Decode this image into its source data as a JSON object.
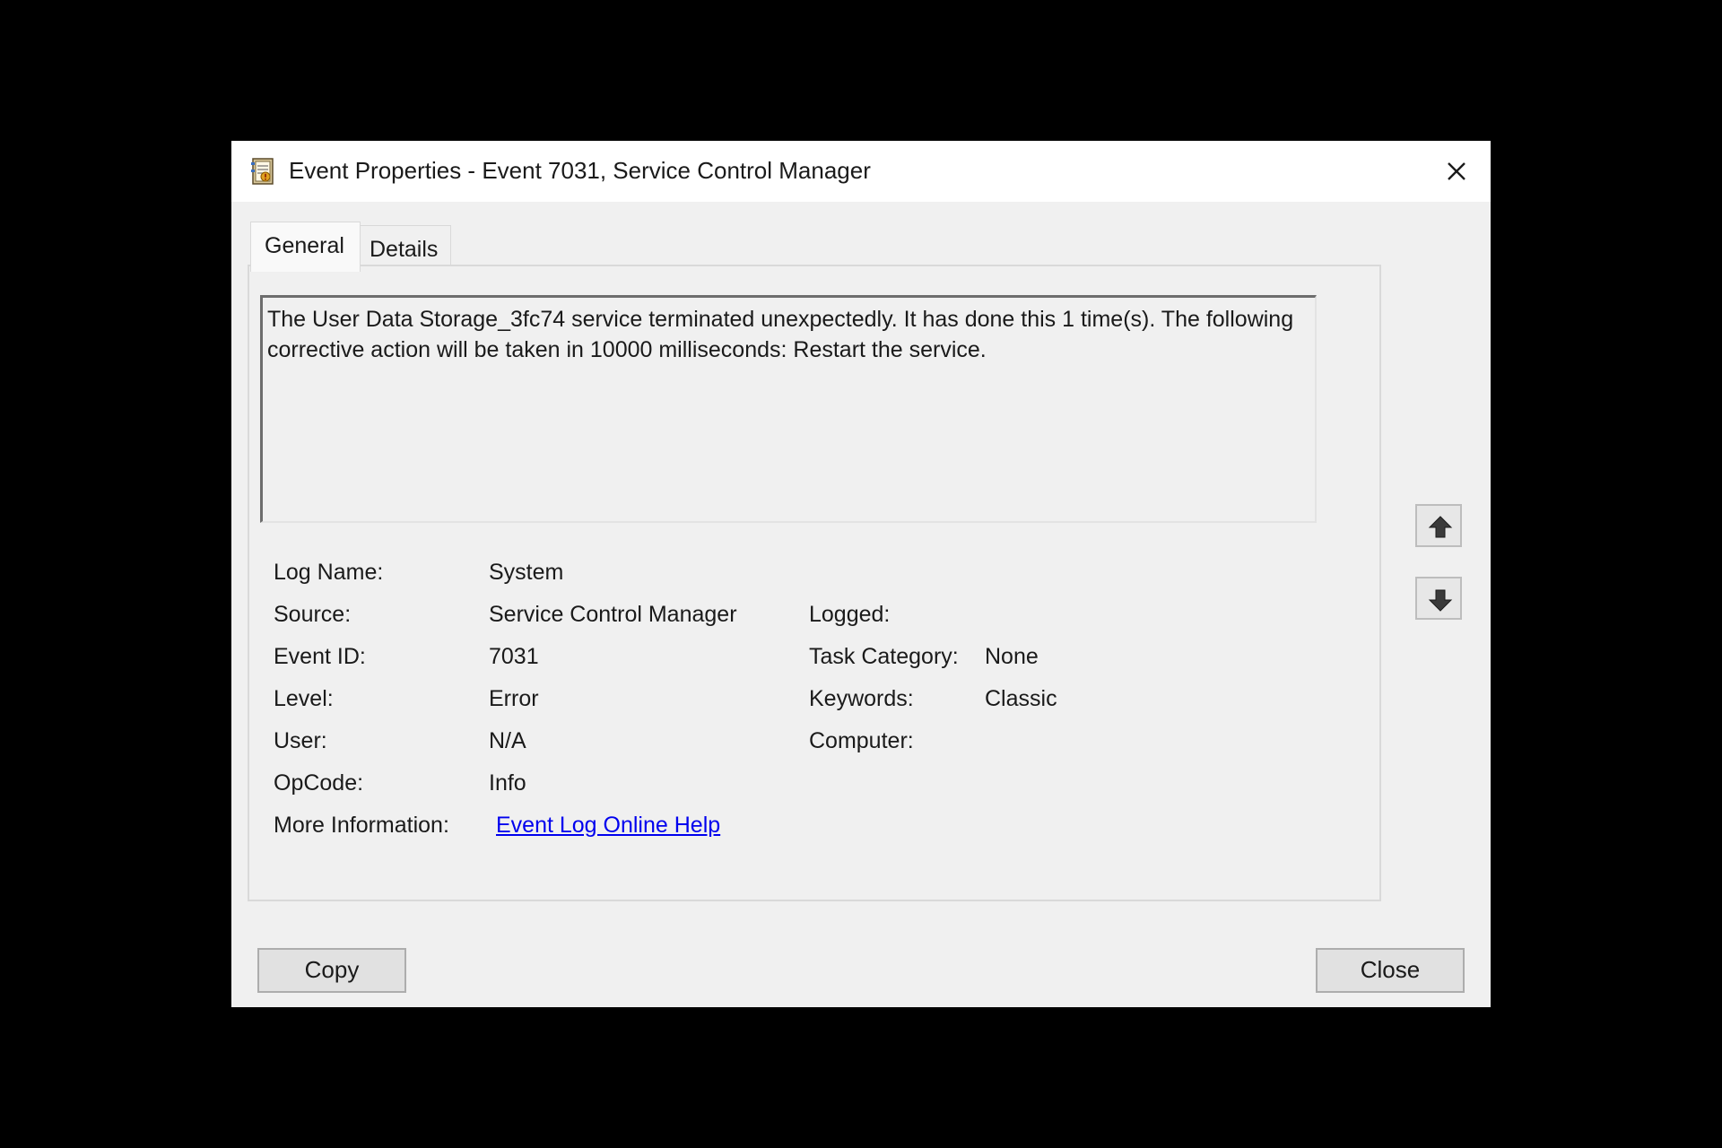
{
  "window": {
    "title": "Event Properties - Event 7031, Service Control Manager",
    "icon": "event-viewer-icon",
    "close_icon": "close-icon"
  },
  "tabs": [
    {
      "label": "General",
      "selected": true
    },
    {
      "label": "Details",
      "selected": false
    }
  ],
  "description": "The User Data Storage_3fc74 service terminated unexpectedly. It has done this 1 time(s). The following corrective action will be taken in 10000 milliseconds: Restart the service.",
  "fields": {
    "log_name": {
      "label": "Log Name:",
      "value": "System"
    },
    "source": {
      "label": "Source:",
      "value": "Service Control Manager"
    },
    "logged": {
      "label": "Logged:",
      "value": ""
    },
    "event_id": {
      "label": "Event ID:",
      "value": "7031"
    },
    "task_category": {
      "label": "Task Category:",
      "value": "None"
    },
    "level": {
      "label": "Level:",
      "value": "Error"
    },
    "keywords": {
      "label": "Keywords:",
      "value": "Classic"
    },
    "user": {
      "label": "User:",
      "value": "N/A"
    },
    "computer": {
      "label": "Computer:",
      "value": ""
    },
    "opcode": {
      "label": "OpCode:",
      "value": "Info"
    },
    "more_info": {
      "label": "More Information:",
      "value": "Event Log Online Help"
    }
  },
  "nav": {
    "up_icon": "arrow-up-icon",
    "down_icon": "arrow-down-icon"
  },
  "buttons": {
    "copy": "Copy",
    "close": "Close"
  },
  "colors": {
    "dialog_bg": "#f0f0f0",
    "titlebar_bg": "#ffffff",
    "link": "#0000ee",
    "screen_bg": "#000000"
  }
}
